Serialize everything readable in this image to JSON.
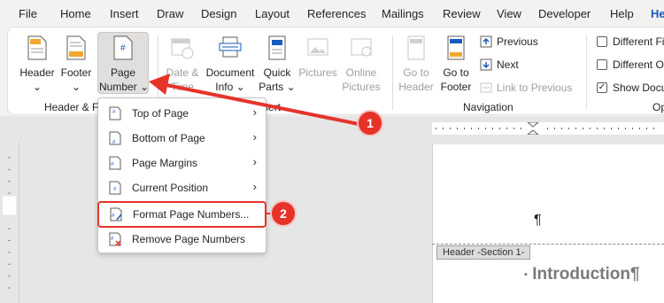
{
  "tabs": [
    "File",
    "Home",
    "Insert",
    "Draw",
    "Design",
    "Layout",
    "References",
    "Mailings",
    "Review",
    "View",
    "Developer",
    "Help",
    "He"
  ],
  "ribbon": {
    "header": {
      "label": "Header",
      "caret": "⌄"
    },
    "footer": {
      "label": "Footer",
      "caret": "⌄"
    },
    "page_number": {
      "line1": "Page",
      "line2": "Number",
      "caret": "⌄"
    },
    "date_time": {
      "line1": "Date &",
      "line2": "Time"
    },
    "document_info": {
      "line1": "Document",
      "line2": "Info",
      "caret": "⌄"
    },
    "quick_parts": {
      "line1": "Quick",
      "line2": "Parts",
      "caret": "⌄"
    },
    "pictures": {
      "label": "Pictures"
    },
    "online_pictures": {
      "line1": "Online",
      "line2": "Pictures"
    },
    "go_to_header": {
      "line1": "Go to",
      "line2": "Header"
    },
    "go_to_footer": {
      "line1": "Go to",
      "line2": "Footer"
    },
    "previous": "Previous",
    "next": "Next",
    "link_to_previous": "Link to Previous",
    "different_first": "Different Fi",
    "different_odd": "Different O",
    "show_document": "Show Docu",
    "group_header_footer": "Header & F",
    "group_insert_tail": "sert",
    "group_navigation": "Navigation",
    "group_options": "Op"
  },
  "menu": {
    "items": [
      {
        "label": "Top of Page",
        "arrow": "›"
      },
      {
        "label": "Bottom of Page",
        "arrow": "›"
      },
      {
        "label": "Page Margins",
        "arrow": "›"
      },
      {
        "label": "Current Position",
        "arrow": "›"
      },
      {
        "label": "Format Page Numbers..."
      },
      {
        "label": "Remove Page Numbers"
      }
    ]
  },
  "document": {
    "pilcrow": "¶",
    "header_tag": "Header -Section 1-",
    "heading": "Introduction¶",
    "heading_marker": "▪"
  },
  "annotations": {
    "badge1": "1",
    "badge2": "2"
  },
  "colors": {
    "accent": "#185abd",
    "annotation_red": "#e5332a"
  }
}
